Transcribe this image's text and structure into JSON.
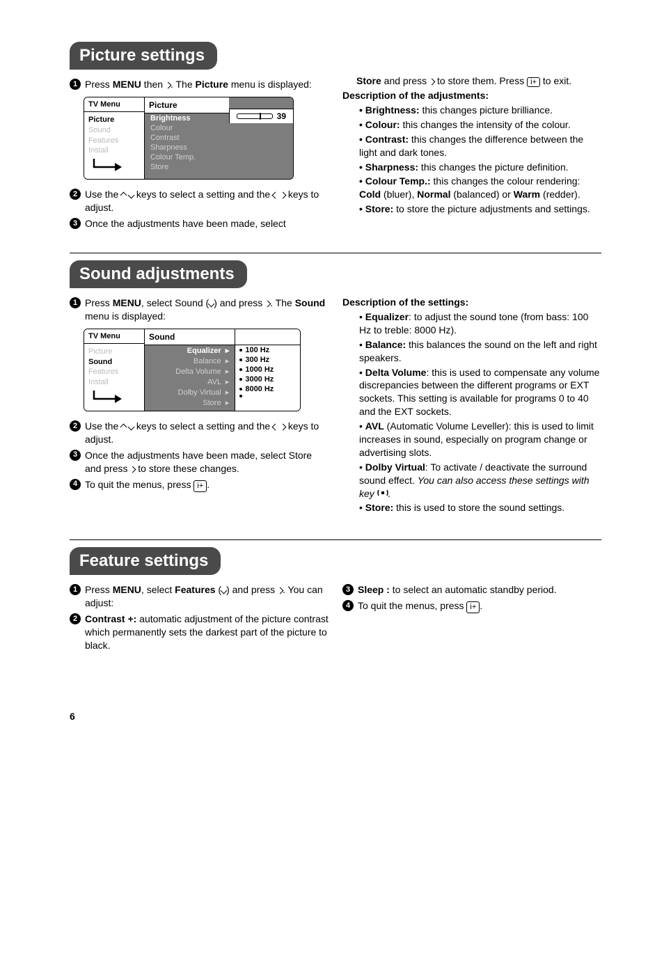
{
  "page_number": "6",
  "picture": {
    "heading": "Picture settings",
    "step1_a": "Press ",
    "step1_menu": "MENU",
    "step1_b": " then ",
    "step1_c": ". The ",
    "step1_picture": "Picture",
    "step1_d": " menu is displayed:",
    "step2_a": "Use the ",
    "step2_b": " keys to select a setting and the ",
    "step2_c": " keys to adjust.",
    "step3": "Once the adjustments have been made, select ",
    "store_a": "Store",
    "store_b": " and press ",
    "store_c": " to store them. Press ",
    "store_d": " to exit.",
    "desc_heading": "Description of the adjustments:",
    "items": {
      "brightness_l": "Brightness:",
      "brightness_t": " this changes picture brilliance.",
      "colour_l": "Colour:",
      "colour_t": " this changes the intensity of the colour.",
      "contrast_l": "Contrast:",
      "contrast_t": " this changes the difference between the light and dark tones.",
      "sharpness_l": "Sharpness:",
      "sharpness_t": " this changes the picture definition.",
      "ctemp_l": "Colour Temp.:",
      "ctemp_t1": " this changes the colour rendering: ",
      "ctemp_cold": "Cold",
      "ctemp_t2": " (bluer), ",
      "ctemp_norm": "Normal",
      "ctemp_t3": " (balanced) or ",
      "ctemp_warm": "Warm",
      "ctemp_t4": " (redder).",
      "store_l": "Store:",
      "store_t": " to store the picture adjustments and settings."
    },
    "osd": {
      "tvmenu": "TV Menu",
      "left": {
        "picture": "Picture",
        "sound": "Sound",
        "features": "Features",
        "install": "Install"
      },
      "center_hdr": "Picture",
      "rows": [
        "Brightness",
        "Colour",
        "Contrast",
        "Sharpness",
        "Colour Temp.",
        "Store"
      ],
      "value": "39"
    }
  },
  "sound": {
    "heading": "Sound adjustments",
    "step1_a": "Press ",
    "step1_menu": "MENU",
    "step1_b": ", select Sound (",
    "step1_c": ") and press ",
    "step1_d": ". The ",
    "step1_sound": "Sound",
    "step1_e": " menu is displayed:",
    "step2_a": "Use the ",
    "step2_b": " keys to select a setting and the ",
    "step2_c": " keys to adjust.",
    "step3_a": "Once the adjustments have been made, select Store and press ",
    "step3_b": " to store these changes.",
    "step4_a": "To quit the menus, press ",
    "step4_b": ".",
    "desc_heading": "Description of the settings:",
    "items": {
      "eq_l": "Equalizer",
      "eq_t": ": to adjust the sound tone (from bass: 100 Hz to treble: 8000 Hz).",
      "bal_l": "Balance:",
      "bal_t": " this balances the sound on the left and right speakers.",
      "dvol_l": "Delta Volume",
      "dvol_t": ": this is used to compensate any volume discrepancies between the different programs or EXT sockets. This setting is available for programs 0 to 40 and the EXT sockets.",
      "avl_l": "AVL",
      "avl_t": " (Automatic Volume Leveller): this is used to limit increases in sound, especially on program change or advertising slots.",
      "dv_l": "Dolby Virtual",
      "dv_t1": ": To activate / deactivate the surround sound effect. ",
      "dv_it": "You can also access these settings with key ",
      "dv_t2": ".",
      "st_l": "Store:",
      "st_t": " this is used to store the sound settings."
    },
    "osd": {
      "tvmenu": "TV Menu",
      "left": {
        "picture": "Picture",
        "sound": "Sound",
        "features": "Features",
        "install": "Install"
      },
      "center_hdr": "Sound",
      "rows_l": [
        "Equalizer",
        "Balance",
        "Delta Volume",
        "AVL",
        "Dolby Virtual",
        "Store"
      ],
      "rows_r": [
        "100 Hz",
        "300 Hz",
        "1000 Hz",
        "3000 Hz",
        "8000 Hz"
      ]
    }
  },
  "feature": {
    "heading": "Feature settings",
    "step1_a": "Press ",
    "step1_menu": "MENU",
    "step1_b": ", select ",
    "step1_feat": "Features",
    "step1_c": " (",
    "step1_d": ") and press ",
    "step1_e": ". You can adjust:",
    "step2_l": "Contrast +:",
    "step2_t": " automatic adjustment of the picture contrast which permanently sets the darkest part of the picture to black.",
    "step3_l": "Sleep :",
    "step3_t": " to select an automatic standby period.",
    "step4_a": "To quit the menus, press ",
    "step4_b": "."
  },
  "glyphs": {
    "info": "i+"
  }
}
